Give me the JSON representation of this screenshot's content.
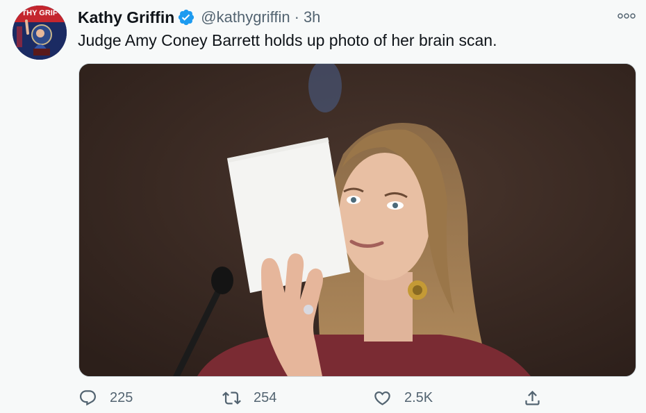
{
  "tweet": {
    "display_name": "Kathy Griffin",
    "handle": "@kathygriffin",
    "separator": "·",
    "time": "3h",
    "text": "Judge Amy Coney Barrett holds up photo of her brain scan.",
    "verified": true,
    "avatar_text": "THY GRIF"
  },
  "actions": {
    "replies": "225",
    "retweets": "254",
    "likes": "2.5K"
  },
  "icons": {
    "verified": "verified-badge-icon",
    "more": "more-options-icon",
    "reply": "reply-icon",
    "retweet": "retweet-icon",
    "like": "like-icon",
    "share": "share-icon"
  },
  "colors": {
    "verified_blue": "#1d9bf0",
    "secondary_text": "#536471",
    "background": "#f7f9f9"
  }
}
